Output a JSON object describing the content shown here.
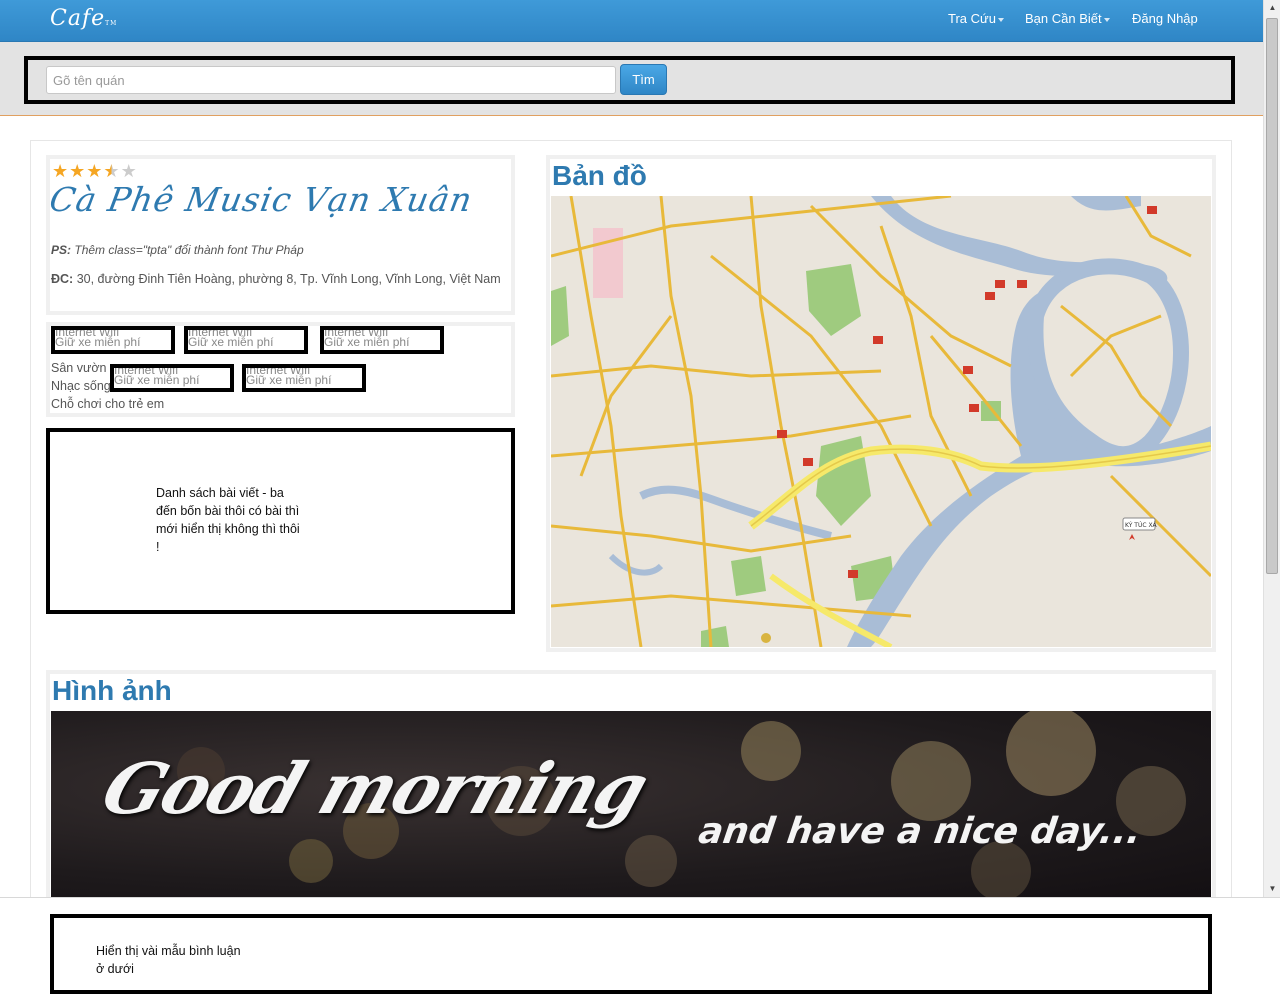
{
  "navbar": {
    "logo": "Cafe",
    "logo_mark": "TM",
    "items": [
      {
        "label": "Tra Cứu"
      },
      {
        "label": "Bạn Cần Biết"
      },
      {
        "label": "Đăng Nhập"
      }
    ]
  },
  "search": {
    "placeholder": "Gõ tên quán",
    "button_label": "Tìm"
  },
  "cafe": {
    "rating": 3.5,
    "rating_max": 5,
    "name": "Cà Phê Music Vạn Xuân",
    "ps_label": "PS:",
    "ps_text": "Thêm class=\"tpta\" đổi thành font Thư Pháp",
    "address_label": "ĐC:",
    "address_text": "30, đường Đinh Tiên Hoàng, phường 8, Tp. Vĩnh Long, Vĩnh Long, Việt Nam"
  },
  "amenities": {
    "cells": [
      {
        "line1": "Internet Wifi",
        "line2": "Giữ xe miễn phí"
      },
      {
        "line1": "Internet Wifi",
        "line2": "Giữ xe miễn phí"
      },
      {
        "line1": "Internet Wifi",
        "line2": "Giữ xe miễn phí"
      },
      {
        "line1": "Internet Wifi",
        "line2": "Giữ xe miễn phí"
      },
      {
        "line1": "Internet Wifi",
        "line2": "Giữ xe miễn phí"
      }
    ],
    "extra": [
      "Sân vườn",
      "Nhạc sống",
      "Chỗ chơi cho trẻ em"
    ]
  },
  "posts_note": "Danh sách bài viết - ba đến bốn bài thôi có bài thì mới hiển thị không thì thôi !",
  "map": {
    "title": "Bản đồ",
    "pin_label": "KÝ TÚC XÁ",
    "colors": {
      "land": "#eae5dc",
      "river": "#a9bdd6",
      "road": "#e8b93a",
      "park": "#9fcb7f",
      "highway": "#f6e96a"
    }
  },
  "gallery": {
    "title": "Hình ảnh",
    "image_line1": "Good morning",
    "image_line2": "and have a nice day..."
  },
  "comments_note": "Hiển thị vài mẫu bình luận ở dưới",
  "colors": {
    "accent": "#2f86c6",
    "title": "#2e7ab0"
  }
}
